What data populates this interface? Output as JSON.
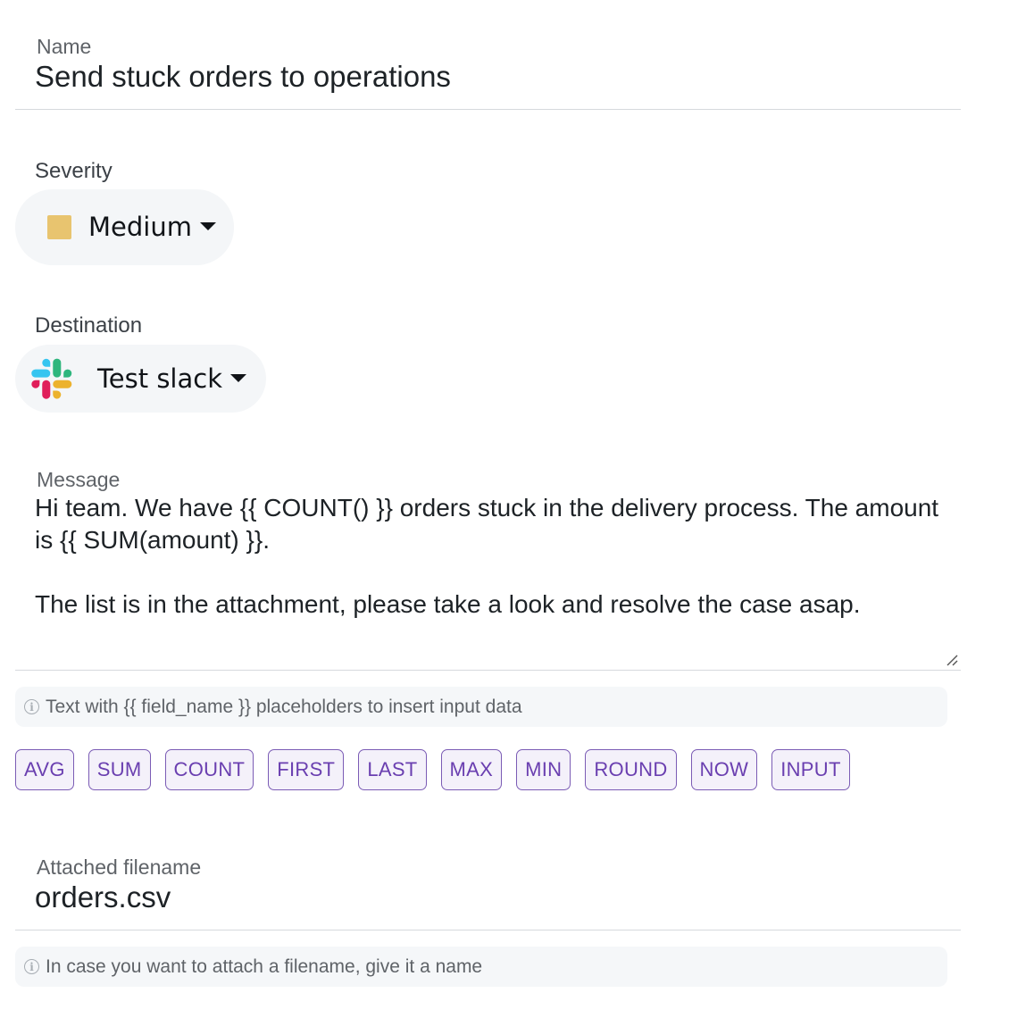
{
  "name": {
    "label": "Name",
    "value": "Send stuck orders to operations"
  },
  "severity": {
    "label": "Severity",
    "selected": "Medium",
    "color": "#e8c46f"
  },
  "destination": {
    "label": "Destination",
    "selected": "Test slack",
    "icon": "slack-icon"
  },
  "message": {
    "label": "Message",
    "value": "Hi team. We have {{ COUNT() }} orders stuck in the delivery process. The amount is {{ SUM(amount) }}.\n\nThe list is in the attachment, please take a look and resolve the case asap.",
    "hint": "Text with {{ field_name }} placeholders to insert input data"
  },
  "functions": [
    "AVG",
    "SUM",
    "COUNT",
    "FIRST",
    "LAST",
    "MAX",
    "MIN",
    "ROUND",
    "NOW",
    "INPUT"
  ],
  "attachment": {
    "label": "Attached filename",
    "value": "orders.csv",
    "hint": "In case you want to attach a filename, give it a name"
  },
  "colors": {
    "accent": "#6a3fb0",
    "chip_border": "#7b5cb5",
    "chip_bg": "#f4f1fa",
    "pill_bg": "#f4f6f8"
  }
}
